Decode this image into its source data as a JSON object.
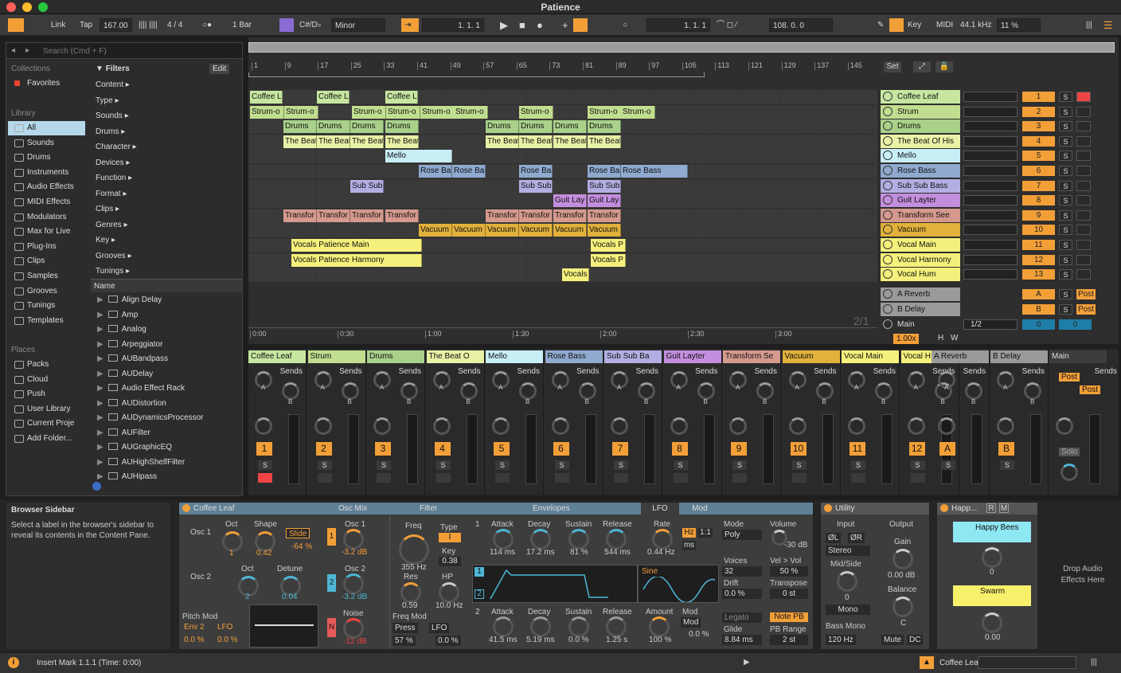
{
  "window": {
    "title": "Patience"
  },
  "transport": {
    "link": "Link",
    "tap": "Tap",
    "tempo": "167.00",
    "sig": "4 / 4",
    "quant": "1 Bar",
    "key": "C#/D♭",
    "scale": "Minor",
    "pos": "1.   1.   1",
    "loop_start": "1.   1.   1",
    "loop_len": "108.   0.   0",
    "key_label": "Key",
    "midi": "MIDI",
    "sample_rate": "44.1 kHz",
    "cpu": "11 %"
  },
  "browser": {
    "search_placeholder": "Search (Cmd + F)",
    "collections_h": "Collections",
    "favorites": "Favorites",
    "library_h": "Library",
    "library": [
      "All",
      "Sounds",
      "Drums",
      "Instruments",
      "Audio Effects",
      "MIDI Effects",
      "Modulators",
      "Max for Live",
      "Plug-Ins",
      "Clips",
      "Samples",
      "Grooves",
      "Tunings",
      "Templates"
    ],
    "places_h": "Places",
    "places": [
      "Packs",
      "Cloud",
      "Push",
      "User Library",
      "Current Proje",
      "Add Folder..."
    ],
    "filters_label": "Filters",
    "edit_label": "Edit",
    "filters": [
      "Content ▸",
      "Type ▸",
      "Sounds ▸",
      "Drums ▸",
      "Character ▸",
      "Devices ▸",
      "Function ▸",
      "Format ▸",
      "Clips ▸",
      "Genres ▸",
      "Key ▸",
      "Grooves ▸",
      "Tunings ▸"
    ],
    "name_header": "Name",
    "names": [
      "Align Delay",
      "Amp",
      "Analog",
      "Arpeggiator",
      "AUBandpass",
      "AUDelay",
      "Audio Effect Rack",
      "AUDistortion",
      "AUDynamicsProcessor",
      "AUFilter",
      "AUGraphicEQ",
      "AUHighShelfFilter",
      "AUHipass"
    ]
  },
  "arrangement": {
    "bars": [
      "1",
      "9",
      "17",
      "25",
      "33",
      "41",
      "49",
      "57",
      "65",
      "73",
      "81",
      "89",
      "97",
      "105",
      "113",
      "121",
      "129",
      "137",
      "145"
    ],
    "set_label": "Set",
    "time_marks": [
      "0:00",
      "0:30",
      "1:00",
      "1:30",
      "2:00",
      "2:30",
      "3:00"
    ],
    "page": "2/1",
    "zoom": "1.00x",
    "h": "H",
    "w": "W",
    "tracks": [
      {
        "name": "Coffee Leaf",
        "num": "1",
        "color": "#c7e6a0"
      },
      {
        "name": "Strum",
        "num": "2",
        "color": "#c1dd8f"
      },
      {
        "name": "Drums",
        "num": "3",
        "color": "#a9d18a"
      },
      {
        "name": "The Beat Of His",
        "num": "4",
        "color": "#e9f1a6"
      },
      {
        "name": "Mello",
        "num": "5",
        "color": "#c8eef6"
      },
      {
        "name": "Rose Bass",
        "num": "6",
        "color": "#8fa9cf"
      },
      {
        "name": "Sub Sub Bass",
        "num": "7",
        "color": "#b3aee2"
      },
      {
        "name": "Guit Layter",
        "num": "8",
        "color": "#c38edd"
      },
      {
        "name": "Transform See",
        "num": "9",
        "color": "#d5998e"
      },
      {
        "name": "Vacuum",
        "num": "10",
        "color": "#e2b13b"
      },
      {
        "name": "Vocal Main",
        "num": "11",
        "color": "#f5f07b"
      },
      {
        "name": "Vocal Harmony",
        "num": "12",
        "color": "#f5f07b"
      },
      {
        "name": "Vocal Hum",
        "num": "13",
        "color": "#f5f07b"
      }
    ],
    "returns": [
      {
        "name": "A Reverb",
        "num": "A",
        "post": "Post"
      },
      {
        "name": "B Delay",
        "num": "B",
        "post": "Post"
      }
    ],
    "main": {
      "name": "Main",
      "sig": "1/2",
      "a": "0",
      "b": "0"
    },
    "clip_labels": {
      "coffee": "Coffee L",
      "strum": "Strum-o",
      "drums": "Drums",
      "beat": "The Beat",
      "mello": "Mello",
      "rose": "Rose Bas",
      "rose_full": "Rose Bass",
      "sub": "Sub Sub",
      "guit": "Guit Lay",
      "transf": "Transfor",
      "vac": "Vacuum",
      "voc_main": "Vocals Patience Main",
      "voc_harm": "Vocals Patience Harmony",
      "voc_p": "Vocals P",
      "voc": "Vocals"
    }
  },
  "mixer": {
    "sends": "Sends",
    "a": "A",
    "b": "B",
    "post": "Post",
    "solo": "Solo",
    "strips": [
      {
        "name": "Coffee Leaf",
        "num": "1",
        "color": "#c7e6a0"
      },
      {
        "name": "Strum",
        "num": "2",
        "color": "#c1dd8f"
      },
      {
        "name": "Drums",
        "num": "3",
        "color": "#a9d18a"
      },
      {
        "name": "The Beat O",
        "num": "4",
        "color": "#e9f1a6"
      },
      {
        "name": "Mello",
        "num": "5",
        "color": "#c8eef6"
      },
      {
        "name": "Rose Bass",
        "num": "6",
        "color": "#8fa9cf"
      },
      {
        "name": "Sub Sub Ba",
        "num": "7",
        "color": "#b3aee2"
      },
      {
        "name": "Guit Layter",
        "num": "8",
        "color": "#c38edd"
      },
      {
        "name": "Transform Se",
        "num": "9",
        "color": "#d5998e"
      },
      {
        "name": "Vacuum",
        "num": "10",
        "color": "#e2b13b"
      },
      {
        "name": "Vocal Main",
        "num": "11",
        "color": "#f5f07b"
      },
      {
        "name": "Vocal H",
        "num": "12",
        "color": "#f5f07b"
      },
      {
        "name": "A Reverb",
        "num": "A",
        "color": "#9a9a9a"
      },
      {
        "name": "B Delay",
        "num": "B",
        "color": "#9a9a9a"
      },
      {
        "name": "Main",
        "num": "",
        "color": "#3d3d3d"
      }
    ]
  },
  "info": {
    "title": "Browser Sidebar",
    "text": "Select a label in the browser's sidebar to reveal its contents in the Content Pane."
  },
  "synth": {
    "title": "Coffee Leaf",
    "osc_mix": "Osc Mix",
    "filter": "Filter",
    "envelopes": "Envelopes",
    "lfo_tab": "LFO",
    "mod_tab": "Mod",
    "osc1": "Osc 1",
    "osc2": "Osc 2",
    "oct": "Oct",
    "shape": "Shape",
    "detune": "Detune",
    "oct1": "1",
    "shape_v": "0.42",
    "slide": "Slide",
    "slide_v": "-64 %",
    "oct2": "2",
    "detune_v": "0.04",
    "osc1_lbl": "Osc 1",
    "osc1_db": "-3.2 dB",
    "osc2_lbl": "Osc 2",
    "osc2_db": "-3.2 dB",
    "noise": "Noise",
    "noise_db": "-12 dB",
    "pitch_mod": "Pitch Mod",
    "env2": "Env 2",
    "lfo": "LFO",
    "pm1": "0.0 %",
    "pm2": "0.0 %",
    "freq": "Freq",
    "freq_v": "355 Hz",
    "type": "Type",
    "type_v": "I",
    "key": "Key",
    "key_v": "0.38",
    "res": "Res",
    "res_v": "0.59",
    "hp": "HP",
    "hp_v": "10.0 Hz",
    "freq_mod": "Freq Mod",
    "press": "Press",
    "fm_lfo": "LFO",
    "fm1": "57 %",
    "fm2": "0.0 %",
    "e1": "1",
    "attack": "Attack",
    "decay": "Decay",
    "sustain": "Sustain",
    "release": "Release",
    "a1": "114 ms",
    "d1": "17.2 ms",
    "s1": "81 %",
    "r1": "544 ms",
    "e2": "2",
    "a2": "41.5 ms",
    "d2": "5.19 ms",
    "s2": "0.0 %",
    "r2": "1.25 s",
    "sine": "Sine",
    "rate": "Rate",
    "rate_v": "0.44 Hz",
    "hz": "Hz",
    "ratio": "1:1",
    "ms": "ms",
    "amount": "Amount",
    "amount_v": "100 %",
    "mod": "Mod",
    "mod_v": "0.0 %",
    "mode": "Mode",
    "mode_v": "Poly",
    "voices": "Voices",
    "voices_v": "32",
    "drift": "Drift",
    "drift_v": "0.0 %",
    "legato": "Legato",
    "glide": "Glide",
    "glide_v": "8.84 ms",
    "volume": "Volume",
    "volume_v": "-30 dB",
    "velvol": "Vel > Vol",
    "velvol_v": "50 %",
    "transpose": "Transpose",
    "transpose_v": "0 st",
    "notepb": "Note PB",
    "pbrange": "PB Range",
    "pbrange_v": "2 st"
  },
  "utility": {
    "title": "Utility",
    "input": "Input",
    "output": "Output",
    "phl": "ØL",
    "phr": "ØR",
    "stereo": "Stereo",
    "midside": "Mid/Side",
    "ms_v": "0",
    "mono": "Mono",
    "gain": "Gain",
    "gain_v": "0.00 dB",
    "balance": "Balance",
    "bal_v": "C",
    "bassmono": "Bass Mono",
    "bm_v": "120 Hz",
    "mute": "Mute",
    "dc": "DC"
  },
  "rack": {
    "title": "Happ...",
    "r": "R",
    "m": "M",
    "macro1": "Happy Bees",
    "m1_v": "0",
    "macro2": "Swarm",
    "m2_v": "0.00"
  },
  "drop": "Drop Audio Effects Here",
  "status": {
    "text": "Insert Mark 1.1.1 (Time: 0:00)",
    "track": "Coffee Leaf"
  }
}
